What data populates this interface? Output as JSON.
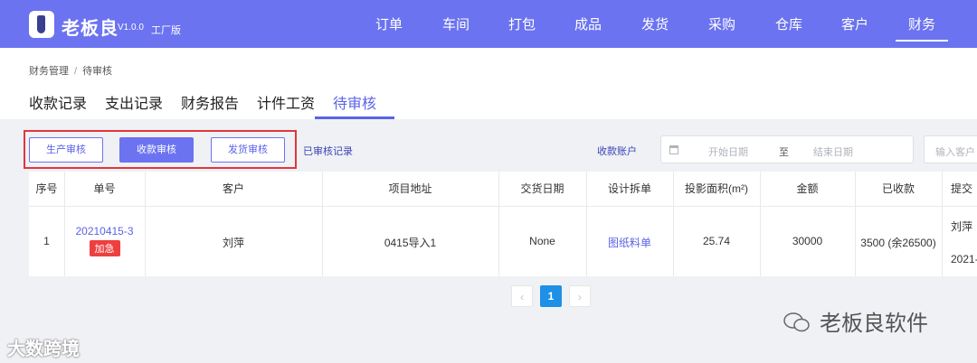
{
  "topbar": {
    "brand": "老板良",
    "version": "V1.0.0",
    "edition": "工厂版",
    "nav": [
      "订单",
      "车间",
      "打包",
      "成品",
      "发货",
      "采购",
      "仓库",
      "客户",
      "财务"
    ],
    "active_nav": "财务",
    "bg_color": "#6b73f0"
  },
  "breadcrumb": {
    "root": "财务管理",
    "sep": "/",
    "current": "待审核"
  },
  "tabs": [
    "收款记录",
    "支出记录",
    "财务报告",
    "计件工资",
    "待审核"
  ],
  "active_tab": "待审核",
  "toolbar": {
    "btn_production": "生产审核",
    "btn_payment": "收款审核",
    "btn_shipping": "发货审核",
    "audited_link": "已审核记录",
    "account_label": "收款账户",
    "start_date_placeholder": "开始日期",
    "date_sep": "至",
    "end_date_placeholder": "结束日期",
    "customer_placeholder": "输入客户"
  },
  "table": {
    "headers": [
      "序号",
      "单号",
      "客户",
      "项目地址",
      "交货日期",
      "设计拆单",
      "投影面积(m²)",
      "金额",
      "已收款",
      "提交"
    ],
    "rows": [
      {
        "index": "1",
        "order_no": "20210415-3",
        "urgent_tag": "加急",
        "customer": "刘萍",
        "address": "0415导入1",
        "delivery_date": "None",
        "design": "图纸料单",
        "area": "25.74",
        "amount": "30000",
        "received": "3500 (余26500)",
        "submitter": "刘萍",
        "submit_date": "2021-"
      }
    ]
  },
  "pagination": {
    "prev": "‹",
    "page": "1",
    "next": "›"
  },
  "watermarks": {
    "right": "老板良软件",
    "left": "大数跨境"
  }
}
